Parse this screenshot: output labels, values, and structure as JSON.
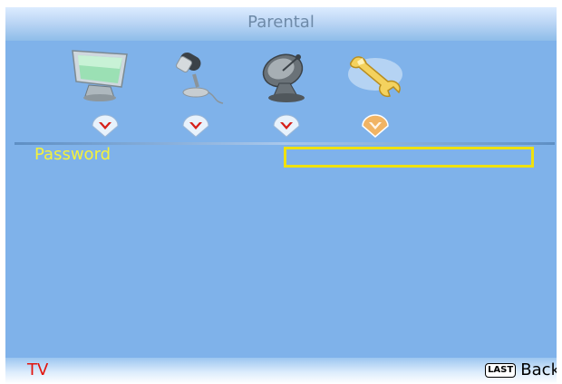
{
  "header": {
    "title": "Parental"
  },
  "tabs": [
    {
      "icon": "monitor-icon"
    },
    {
      "icon": "microphone-icon"
    },
    {
      "icon": "satellite-dish-icon"
    },
    {
      "icon": "wrench-icon",
      "active": true
    }
  ],
  "form": {
    "password_label": "Password",
    "password_value": ""
  },
  "footer": {
    "source": "TV",
    "back_key": "LAST",
    "back_label": "Back"
  },
  "colors": {
    "background": "#7fb2ea",
    "label": "#f5f23a",
    "input_border": "#efe10f",
    "source_text": "#e2140d",
    "marker_inactive": "#e8f2fc",
    "marker_active": "#f1b464",
    "marker_v": "#d6201a"
  }
}
